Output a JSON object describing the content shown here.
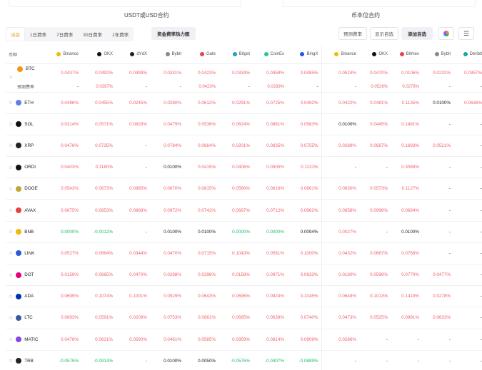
{
  "sections": {
    "usdt_title": "USDT或USD合约",
    "coin_title": "币本位合约"
  },
  "tabs": [
    {
      "label": "当前"
    },
    {
      "label": "1日费率"
    },
    {
      "label": "7日费率"
    },
    {
      "label": "30日费率"
    },
    {
      "label": "1年费率"
    }
  ],
  "heatmap_button": "资金费率热力图",
  "right_buttons": {
    "predict": "预测费率",
    "show_favorites": "显示自选",
    "add_favorite": "添加自选"
  },
  "colors": {
    "red": "#f0626b",
    "green": "#1eba69",
    "accent": "#e8a23a"
  },
  "header": {
    "coin": "币种",
    "usdt": [
      "Binance",
      "OKX",
      "dYdX",
      "Bybit",
      "Gate",
      "Bitget",
      "CoinEx",
      "BingX"
    ],
    "coinm": [
      "Binance",
      "OKX",
      "Bitmex",
      "Bybit",
      "Deribit"
    ]
  },
  "predict_label": "预测费率",
  "predict_row": {
    "usdt": [
      "-",
      "0.0397%",
      "-",
      "-",
      "0.0423%",
      "-",
      "0.0289%",
      "-"
    ],
    "coinm": [
      "-",
      "0.0526%",
      "0.0278%",
      "-",
      "-"
    ]
  },
  "rows": [
    {
      "coin": "BTC",
      "usdt": [
        "0.0437%",
        "0.0492%",
        "0.0499%",
        "0.0331%",
        "0.0423%",
        "0.0334%",
        "0.0459%",
        "0.0485%"
      ],
      "coinm": [
        "0.0524%",
        "0.0470%",
        "0.0106%",
        "0.0232%",
        "0.0357%"
      ]
    },
    {
      "coin": "ETH",
      "usdt": [
        "0.0496%",
        "0.0455%",
        "0.0245%",
        "0.0280%",
        "0.0612%",
        "0.0291%",
        "0.0725%",
        "0.0492%"
      ],
      "coinm": [
        "0.0422%",
        "0.0481%",
        "0.1135%",
        "0.0100%",
        "0.0636%"
      ]
    },
    {
      "coin": "SOL",
      "usdt": [
        "0.0314%",
        "0.0571%",
        "0.0828%",
        "0.0479%",
        "0.0536%",
        "0.0624%",
        "0.0981%",
        "0.0583%"
      ],
      "coinm": [
        "0.0100%",
        "0.0445%",
        "0.1491%",
        "-",
        "-"
      ]
    },
    {
      "coin": "XRP",
      "usdt": [
        "0.0476%",
        "0.0735%",
        "-",
        "0.0784%",
        "0.0664%",
        "0.0201%",
        "0.0835%",
        "0.0755%"
      ],
      "coinm": [
        "0.0289%",
        "0.0687%",
        "0.1693%",
        "0.0521%",
        "-"
      ]
    },
    {
      "coin": "ORDI",
      "usdt": [
        "0.0403%",
        "0.1180%",
        "-",
        "0.0100%",
        "0.0415%",
        "0.0406%",
        "0.0905%",
        "0.1131%"
      ],
      "coinm": [
        "-",
        "-",
        "0.3088%",
        "-",
        "-"
      ]
    },
    {
      "coin": "DOGE",
      "usdt": [
        "0.0543%",
        "0.0673%",
        "0.0885%",
        "0.0670%",
        "0.0815%",
        "0.0566%",
        "0.0616%",
        "0.0661%"
      ],
      "coinm": [
        "0.0630%",
        "0.0573%",
        "0.1127%",
        "-",
        "-"
      ]
    },
    {
      "coin": "AVAX",
      "usdt": [
        "0.0675%",
        "0.0853%",
        "0.0868%",
        "0.0972%",
        "0.0742%",
        "0.0687%",
        "0.0712%",
        "0.0962%"
      ],
      "coinm": [
        "0.0858%",
        "0.0998%",
        "0.0694%",
        "-",
        "-"
      ]
    },
    {
      "coin": "BNB",
      "usdt": [
        "0.0000%",
        "-0.0012%",
        "-",
        "0.0100%",
        "0.0100%",
        "0.0000%",
        "0.0000%",
        "0.0094%"
      ],
      "coinm": [
        "0.0027%",
        "-",
        "0.0100%",
        "-",
        "-"
      ]
    },
    {
      "coin": "LINK",
      "usdt": [
        "0.0527%",
        "0.0664%",
        "0.0344%",
        "0.0470%",
        "0.0715%",
        "0.1043%",
        "0.0561%",
        "0.1000%"
      ],
      "coinm": [
        "0.0432%",
        "0.0667%",
        "0.0768%",
        "-",
        "-"
      ]
    },
    {
      "coin": "DOT",
      "usdt": [
        "0.0159%",
        "0.0665%",
        "0.0470%",
        "0.0288%",
        "0.0298%",
        "0.0158%",
        "0.0971%",
        "0.0633%"
      ],
      "coinm": [
        "0.0180%",
        "0.0598%",
        "0.0770%",
        "0.0477%",
        "-"
      ]
    },
    {
      "coin": "ADA",
      "usdt": [
        "0.0699%",
        "0.1074%",
        "0.1001%",
        "0.0929%",
        "0.0643%",
        "0.0696%",
        "0.0924%",
        "0.1045%"
      ],
      "coinm": [
        "0.0648%",
        "0.1013%",
        "0.1419%",
        "0.0278%",
        "-"
      ]
    },
    {
      "coin": "LTC",
      "usdt": [
        "0.0693%",
        "0.0591%",
        "0.0209%",
        "0.0753%",
        "0.0661%",
        "0.0695%",
        "0.0639%",
        "0.0740%"
      ],
      "coinm": [
        "0.0473%",
        "0.0525%",
        "0.0991%",
        "0.0633%",
        "-"
      ]
    },
    {
      "coin": "MATIC",
      "usdt": [
        "0.0478%",
        "0.0621%",
        "0.0590%",
        "0.0461%",
        "0.0585%",
        "0.0959%",
        "0.0814%",
        "0.0909%"
      ],
      "coinm": [
        "0.0286%",
        "-",
        "-",
        "-",
        "-"
      ]
    },
    {
      "coin": "TRB",
      "usdt": [
        "-0.0575%",
        "-0.0914%",
        "-",
        "0.0100%",
        "0.0050%",
        "-0.0576%",
        "-0.0407%",
        "-0.0889%"
      ],
      "coinm": [
        "-",
        "-",
        "-",
        "-",
        "-"
      ]
    }
  ]
}
